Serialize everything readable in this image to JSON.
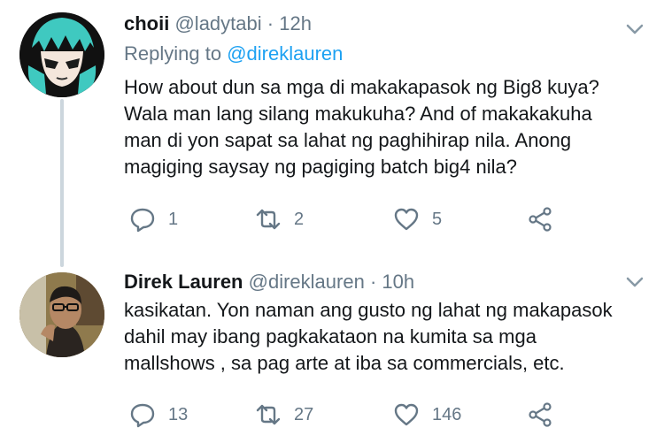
{
  "tweets": [
    {
      "display_name": "choii",
      "handle": "@ladytabi",
      "separator": "·",
      "time": "12h",
      "replying_prefix": "Replying to",
      "replying_to": "@direklauren",
      "text": "How about dun sa mga di makakapasok ng Big8 kuya? Wala man lang silang makukuha? And of makakakuha man di yon sapat sa lahat ng paghihirap nila. Anong magiging saysay ng pagiging batch big4 nila?",
      "avatar_icon": "anime-avatar-icon",
      "reply_count": "1",
      "retweet_count": "2",
      "like_count": "5"
    },
    {
      "display_name": "Direk Lauren",
      "handle": "@direklauren",
      "separator": "·",
      "time": "10h",
      "text": "kasikatan. Yon naman ang gusto ng lahat ng makapasok dahil may ibang pagkakataon na kumita sa mga mallshows , sa pag arte at iba sa commercials, etc.",
      "avatar_icon": "photo-avatar-icon",
      "reply_count": "13",
      "retweet_count": "27",
      "like_count": "146"
    }
  ],
  "colors": {
    "text": "#14171a",
    "secondary": "#657786",
    "link": "#1da1f2",
    "thread_line": "#ccd6dd"
  }
}
